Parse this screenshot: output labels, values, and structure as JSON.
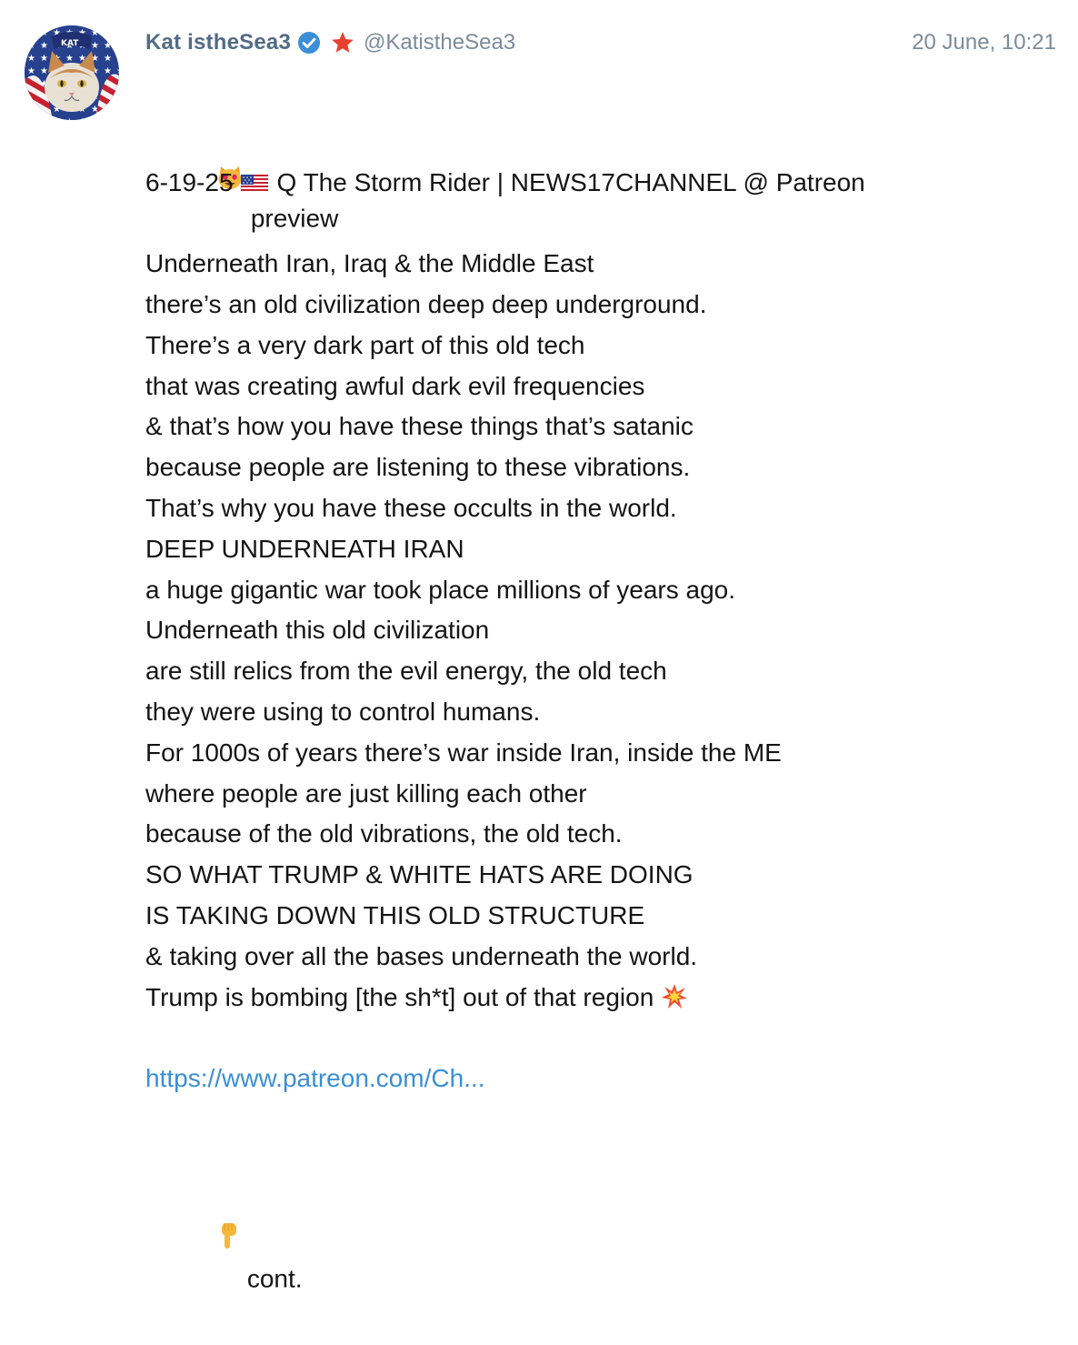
{
  "post": {
    "author_name": "Kat istheSea3",
    "author_handle": "@KatistheSea3",
    "timestamp": "20 June, 10:21",
    "preview_label": "preview",
    "title_date": "6-19-25",
    "title_text": "Q The Storm Rider | NEWS17CHANNEL @ Patreon",
    "body_lines": [
      "Underneath Iran, Iraq & the Middle East",
      "there’s an old civilization deep deep underground.",
      "There’s a very dark part of this old tech",
      "that was creating awful dark evil frequencies",
      "& that’s how you have these things that’s satanic",
      "because people are listening to these vibrations.",
      "That’s why you have these occults in the world.",
      "DEEP UNDERNEATH IRAN",
      "a huge gigantic war took place millions of years ago.",
      "Underneath this old civilization",
      "are still relics from the evil energy, the old tech",
      "they were using to control humans.",
      "For 1000s of years there’s war inside Iran, inside the ME",
      "where people are just killing each other",
      "because of the old vibrations, the old tech.",
      "SO WHAT TRUMP & WHITE HATS ARE DOING",
      "IS TAKING DOWN THIS OLD STRUCTURE",
      "& taking over all the bases underneath the world.",
      "Trump is bombing [the sh*t] out of that region"
    ],
    "link_text": "https://www.patreon.com/Ch...",
    "cont_label": "cont."
  },
  "icons": {
    "verified": "verified-badge-icon",
    "star": "star-icon",
    "preview_emoji": "heart-eyes-cat-emoji",
    "flag": "us-flag-icon",
    "explosion": "collision-emoji",
    "pointing": "pointing-down-emoji"
  },
  "colors": {
    "name": "#536b84",
    "meta": "#7c8b99",
    "verified": "#3a8fd6",
    "star": "#e8402f",
    "link": "#3a8fd6",
    "text": "#141414"
  }
}
